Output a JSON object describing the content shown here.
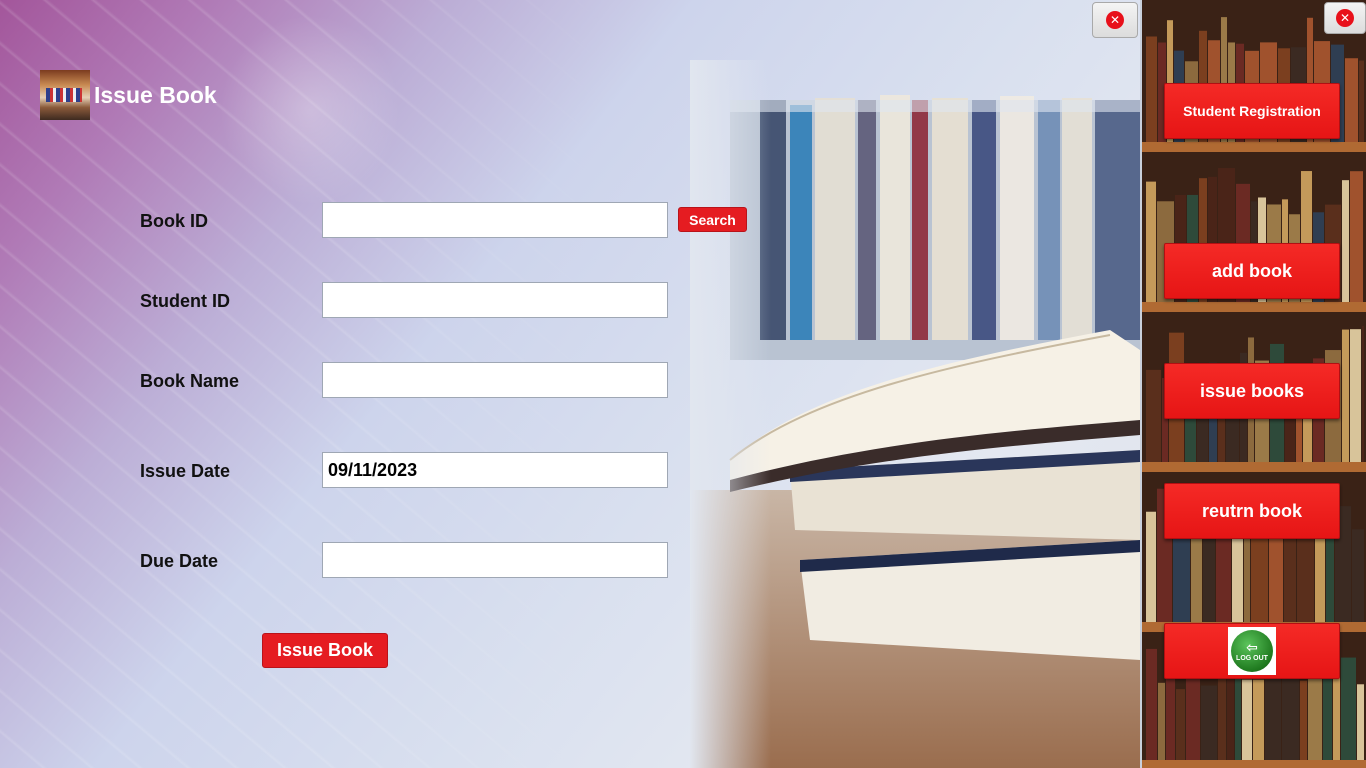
{
  "window": {
    "title": "Issue Book",
    "close_icon_glyph": "✕"
  },
  "form": {
    "book_id": {
      "label": "Book ID",
      "value": ""
    },
    "student_id": {
      "label": "Student ID",
      "value": ""
    },
    "book_name": {
      "label": "Book Name",
      "value": ""
    },
    "issue_date": {
      "label": "Issue Date",
      "value": "09/11/2023"
    },
    "due_date": {
      "label": "Due Date",
      "value": ""
    },
    "search_label": "Search",
    "submit_label": "Issue Book"
  },
  "sidebar": {
    "close_icon_glyph": "✕",
    "items": [
      {
        "label": "Student Registration"
      },
      {
        "label": "add book"
      },
      {
        "label": "issue books"
      },
      {
        "label": "reutrn book"
      }
    ],
    "logout": {
      "icon": "logout-icon",
      "label": "LOG OUT",
      "arrow": "⇦"
    }
  },
  "colors": {
    "accent": "#e51c21",
    "title_text": "#ffffff",
    "label_text": "#111111"
  }
}
